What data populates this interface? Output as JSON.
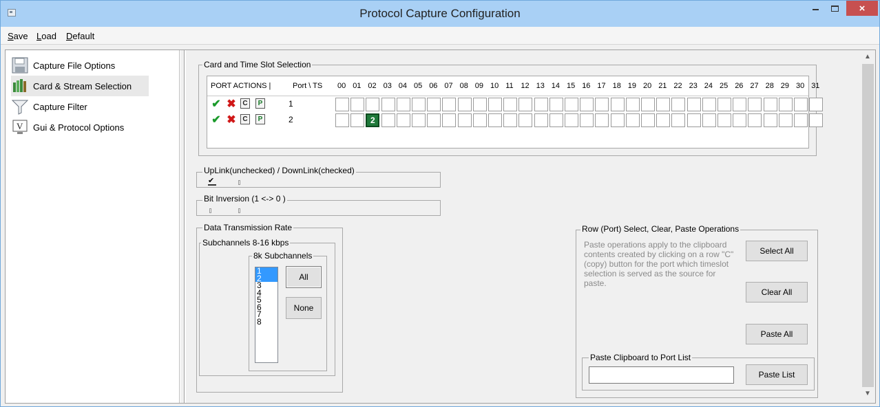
{
  "window": {
    "title": "Protocol Capture Configuration",
    "close_glyph": "×"
  },
  "menu": [
    {
      "pre": "",
      "u": "S",
      "post": "ave"
    },
    {
      "pre": "",
      "u": "L",
      "post": "oad"
    },
    {
      "pre": "",
      "u": "D",
      "post": "efault"
    }
  ],
  "nav": {
    "items": [
      {
        "label": "Capture File Options",
        "icon": "floppy-disk-icon"
      },
      {
        "label": "Card & Stream Selection",
        "icon": "card-stream-icon"
      },
      {
        "label": "Capture Filter",
        "icon": "funnel-icon"
      },
      {
        "label": "Gui & Protocol Options",
        "icon": "monitor-v-icon"
      }
    ],
    "selected": "Card & Stream Selection"
  },
  "card_selection": {
    "legend": "Card and Time Slot Selection",
    "header_actions": "PORT ACTIONS  |",
    "header_port": "Port \\ TS",
    "timeslots": [
      "00",
      "01",
      "02",
      "03",
      "04",
      "05",
      "06",
      "07",
      "08",
      "09",
      "10",
      "11",
      "12",
      "13",
      "14",
      "15",
      "16",
      "17",
      "18",
      "19",
      "20",
      "21",
      "22",
      "23",
      "24",
      "25",
      "26",
      "27",
      "28",
      "29",
      "30",
      "31"
    ],
    "rows": [
      {
        "port": "1",
        "selected_timeslots": []
      },
      {
        "port": "2",
        "selected_timeslots": [
          "02"
        ],
        "selected_label": "2"
      }
    ],
    "icons": [
      "check-icon",
      "x-icon",
      "copy-icon",
      "paste-icon"
    ]
  },
  "uplink": {
    "legend": "UpLink(unchecked) / DownLink(checked)",
    "checkmark": "✔"
  },
  "bit_inversion": {
    "legend": "Bit Inversion (1 <-> 0 )"
  },
  "rate": {
    "legend": "Data Transmission Rate",
    "sub_legend": "Subchannels 8-16 kbps",
    "sub8_legend": "8k Subchannels",
    "items": [
      "1",
      "2",
      "3",
      "4",
      "5",
      "6",
      "7",
      "8"
    ],
    "selected": [
      "1",
      "2"
    ],
    "all_label": "All",
    "none_label": "None"
  },
  "row_ops": {
    "legend": "Row (Port) Select, Clear, Paste Operations",
    "hint": "Paste operations apply to the clipboard contents created by clicking on a row \"C\" (copy) button for the port which timeslot selection is served as the source for paste.",
    "select_all": "Select All",
    "clear_all": "Clear All",
    "paste_all": "Paste All",
    "paste_list_legend": "Paste Clipboard to Port List",
    "paste_list_value": "",
    "paste_list_btn": "Paste List"
  },
  "colors": {
    "titlebar": "#a9d0f5",
    "close": "#c75050",
    "selected_cell": "#1f7a3a"
  }
}
